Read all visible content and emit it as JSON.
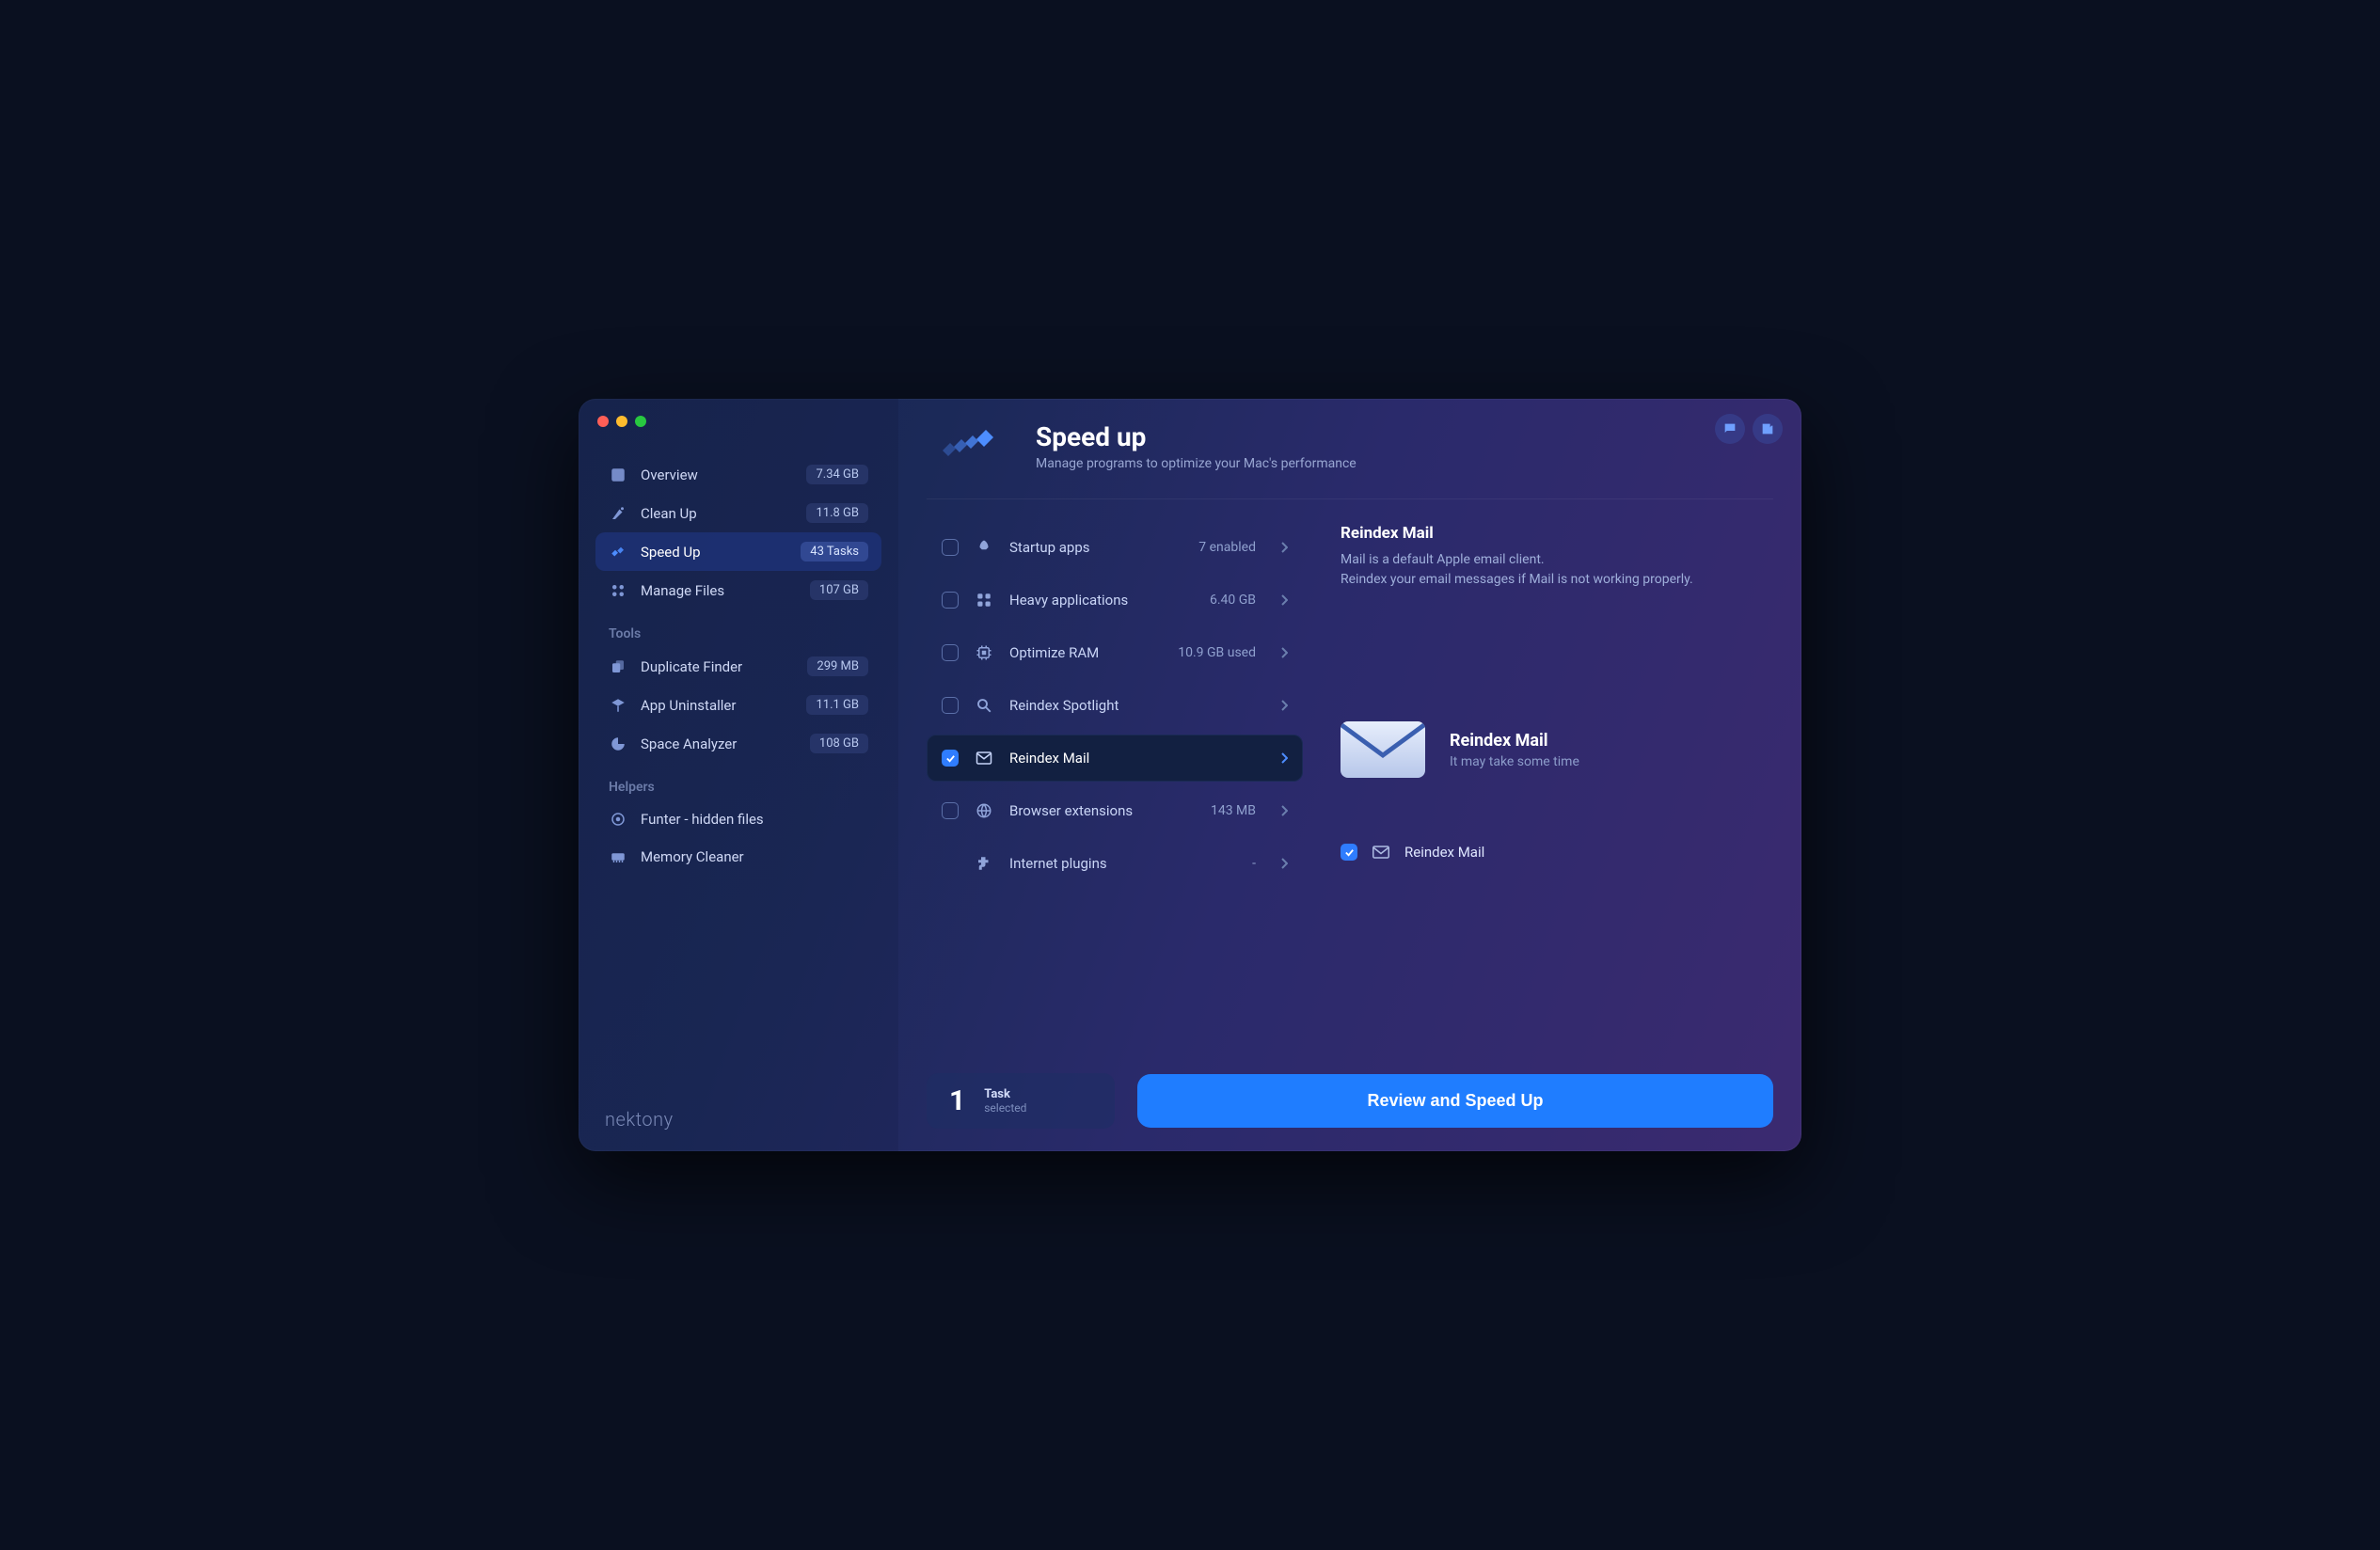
{
  "brand": "nektony",
  "header": {
    "title": "Speed up",
    "subtitle": "Manage programs to optimize your Mac's performance"
  },
  "sidebar": {
    "main": [
      {
        "icon": "overview",
        "label": "Overview",
        "badge": "7.34 GB"
      },
      {
        "icon": "cleanup",
        "label": "Clean Up",
        "badge": "11.8 GB"
      },
      {
        "icon": "speedup",
        "label": "Speed Up",
        "badge": "43 Tasks",
        "active": true
      },
      {
        "icon": "manage",
        "label": "Manage Files",
        "badge": "107 GB"
      }
    ],
    "tools_header": "Tools",
    "tools": [
      {
        "icon": "duplicate",
        "label": "Duplicate Finder",
        "badge": "299 MB"
      },
      {
        "icon": "uninstall",
        "label": "App Uninstaller",
        "badge": "11.1 GB"
      },
      {
        "icon": "analyzer",
        "label": "Space Analyzer",
        "badge": "108 GB"
      }
    ],
    "helpers_header": "Helpers",
    "helpers": [
      {
        "icon": "funter",
        "label": "Funter - hidden files"
      },
      {
        "icon": "memory",
        "label": "Memory Cleaner"
      }
    ]
  },
  "list": [
    {
      "icon": "rocket",
      "label": "Startup apps",
      "value": "7 enabled",
      "checked": false,
      "checkbox": true
    },
    {
      "icon": "grid",
      "label": "Heavy applications",
      "value": "6.40 GB",
      "checked": false,
      "checkbox": true
    },
    {
      "icon": "chip",
      "label": "Optimize RAM",
      "value": "10.9 GB used",
      "checked": false,
      "checkbox": true
    },
    {
      "icon": "search",
      "label": "Reindex Spotlight",
      "value": "",
      "checked": false,
      "checkbox": true
    },
    {
      "icon": "mail",
      "label": "Reindex Mail",
      "value": "",
      "checked": true,
      "checkbox": true,
      "selected": true
    },
    {
      "icon": "globe",
      "label": "Browser extensions",
      "value": "143 MB",
      "checked": false,
      "checkbox": true
    },
    {
      "icon": "plugin",
      "label": "Internet plugins",
      "value": "-",
      "checked": false,
      "checkbox": false
    }
  ],
  "detail": {
    "title": "Reindex Mail",
    "desc_line1": "Mail is a default Apple email client.",
    "desc_line2": "Reindex your email messages if Mail is not working properly.",
    "hero_title": "Reindex Mail",
    "hero_note": "It may take some time",
    "task_label": "Reindex Mail"
  },
  "footer": {
    "count": "1",
    "count_label": "Task",
    "count_sub": "selected",
    "cta": "Review and Speed Up"
  }
}
